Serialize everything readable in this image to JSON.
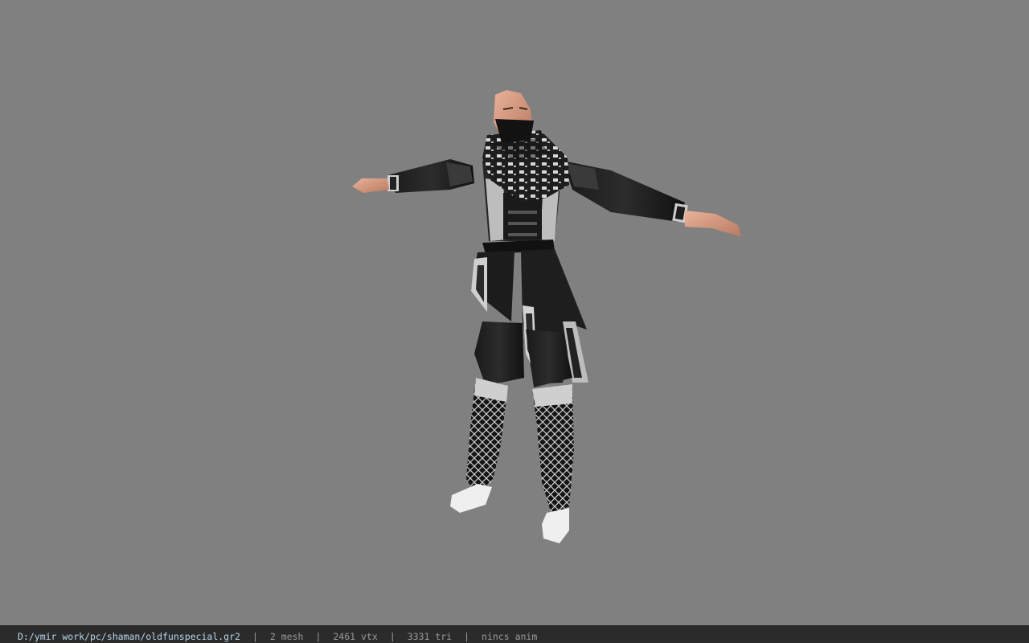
{
  "viewport": {
    "background_color": "#808080",
    "model_preview": "shaman-character-model"
  },
  "statusbar": {
    "path": "D:/ymir work/pc/shaman/oldfunspecial.gr2",
    "separator": "|",
    "mesh": "2 mesh",
    "vtx": "2461 vtx",
    "tri": "3331 tri",
    "anim": "nincs anim",
    "path_color": "#b9d7ec"
  }
}
